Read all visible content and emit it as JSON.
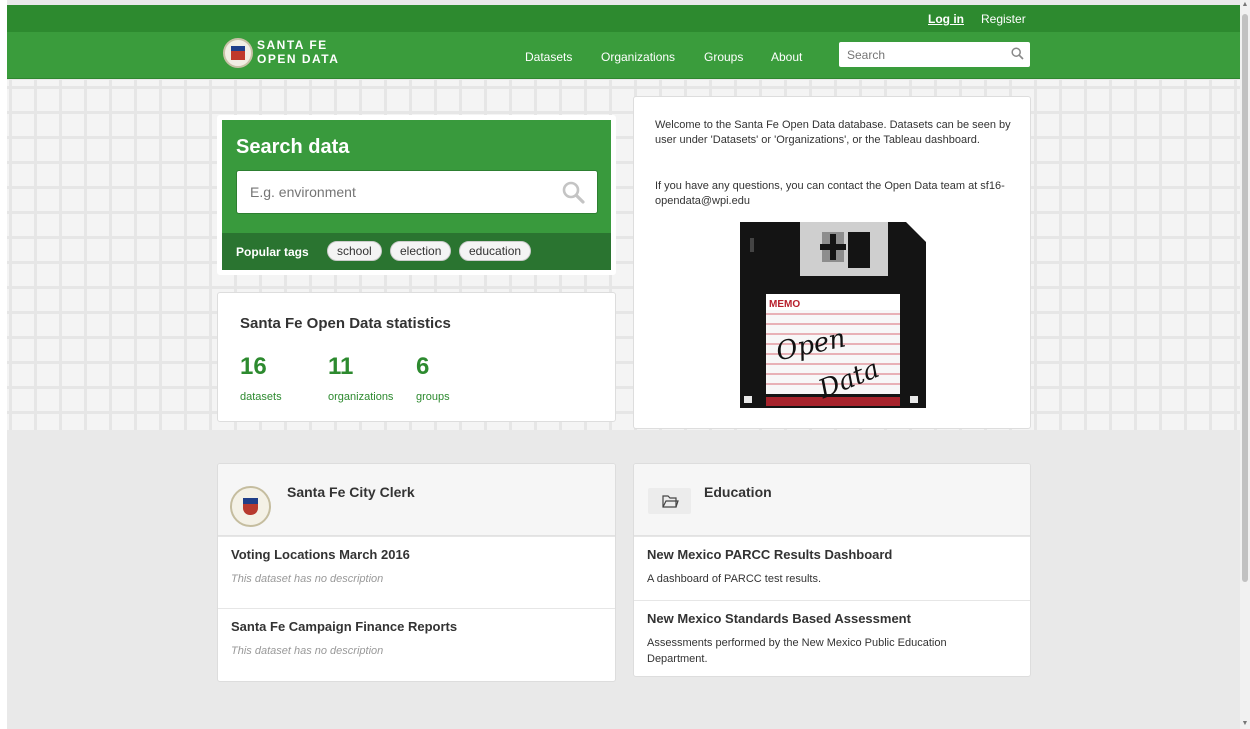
{
  "account": {
    "login": "Log in",
    "register": "Register"
  },
  "site": {
    "logo_line1": "SANTA FE",
    "logo_line2": "OPEN DATA"
  },
  "nav": {
    "datasets": "Datasets",
    "organizations": "Organizations",
    "groups": "Groups",
    "about": "About"
  },
  "header_search": {
    "placeholder": "Search"
  },
  "search_panel": {
    "title": "Search data",
    "placeholder": "E.g. environment",
    "popular_tags_label": "Popular tags",
    "tags": [
      "school",
      "election",
      "education"
    ]
  },
  "stats": {
    "title": "Santa Fe Open Data statistics",
    "items": [
      {
        "value": "16",
        "label": "datasets"
      },
      {
        "value": "11",
        "label": "organizations"
      },
      {
        "value": "6",
        "label": "groups"
      }
    ]
  },
  "welcome": {
    "paragraph1": "Welcome to the Santa Fe Open Data database. Datasets can be seen by user under 'Datasets' or 'Organizations', or the Tableau dashboard.",
    "paragraph2": "If you have any questions, you can contact the Open Data team at sf16-opendata@wpi.edu",
    "image_text": {
      "memo": "MEMO",
      "word1": "Open",
      "word2": "Data"
    }
  },
  "organization_card": {
    "title": "Santa Fe City Clerk",
    "datasets": [
      {
        "title": "Voting Locations March 2016",
        "description": "This dataset has no description"
      },
      {
        "title": "Santa Fe Campaign Finance Reports",
        "description": "This dataset has no description"
      }
    ]
  },
  "group_card": {
    "title": "Education",
    "datasets": [
      {
        "title": "New Mexico PARCC Results Dashboard",
        "description": "A dashboard of PARCC test results."
      },
      {
        "title": "New Mexico Standards Based Assessment",
        "description": "Assessments performed by the New Mexico Public Education Department."
      }
    ]
  },
  "colors": {
    "brand_green": "#3a9c3c",
    "dark_green": "#2a7430",
    "stat_green": "#2d8a2f"
  }
}
